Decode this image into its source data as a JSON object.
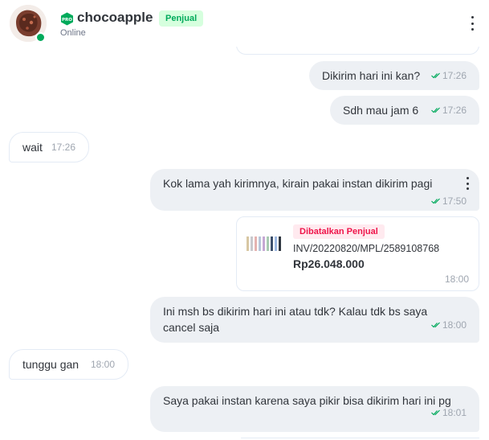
{
  "header": {
    "shop_name": "chocoapple",
    "seller_badge": "Penjual",
    "status": "Online",
    "pro_badge_label": "PRO",
    "avatar_icon": "shop-avatar-icon",
    "menu_icon": "kebab-menu-icon"
  },
  "colors": {
    "accent_green": "#00aa5b",
    "outgoing_bubble": "#edf0f4",
    "incoming_border": "#e4ebf5",
    "cancel_red": "#ef144a"
  },
  "messages": [
    {
      "id": "m1",
      "direction": "outgoing",
      "text": "Dikirim hari ini kan?",
      "time": "17:26",
      "read": true
    },
    {
      "id": "m2",
      "direction": "outgoing",
      "text": "Sdh mau jam 6",
      "time": "17:26",
      "read": true
    },
    {
      "id": "m3",
      "direction": "incoming",
      "text": "wait",
      "time": "17:26"
    },
    {
      "id": "m4",
      "direction": "outgoing",
      "text": "Kok lama yah kirimnya, kirain pakai instan dikirim pagi",
      "time": "17:50",
      "read": true
    },
    {
      "id": "m5",
      "direction": "outgoing",
      "text": "Ini msh bs dikirim hari ini atau tdk? Kalau tdk bs saya cancel saja",
      "time": "18:00",
      "read": true
    },
    {
      "id": "m6",
      "direction": "incoming",
      "text": "tunggu gan",
      "time": "18:00"
    },
    {
      "id": "m7",
      "direction": "outgoing",
      "text": "Saya pakai instan karena saya pikir bisa dikirim hari ini pg",
      "time": "18:01",
      "read": true
    }
  ],
  "invoice": {
    "status_badge": "Dibatalkan Penjual",
    "number": "INV/20220820/MPL/2589108768",
    "price": "Rp26.048.000",
    "time": "18:00",
    "thumbnail_icon": "product-thumbnail-icon"
  }
}
